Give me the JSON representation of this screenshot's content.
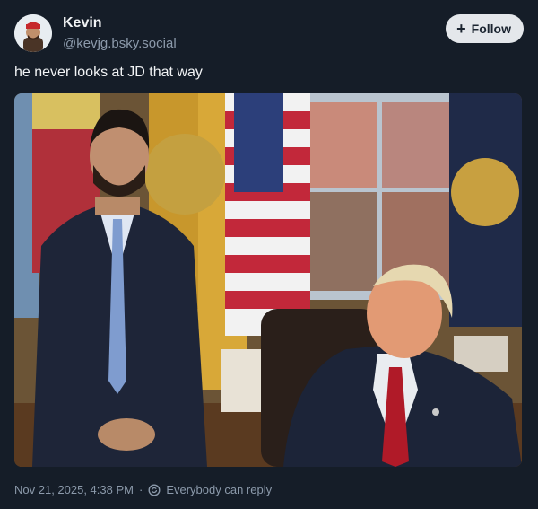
{
  "author": {
    "display_name": "Kevin",
    "handle": "@kevjg.bsky.social"
  },
  "follow_button": {
    "label": "Follow",
    "icon": "plus-icon"
  },
  "post": {
    "text": "he never looks at JD that way",
    "timestamp": "Nov 21, 2025, 4:38 PM",
    "reply_setting": "Everybody can reply"
  },
  "colors": {
    "background": "#151d28",
    "muted": "#8c9aab",
    "button_bg": "#e4e7eb"
  }
}
